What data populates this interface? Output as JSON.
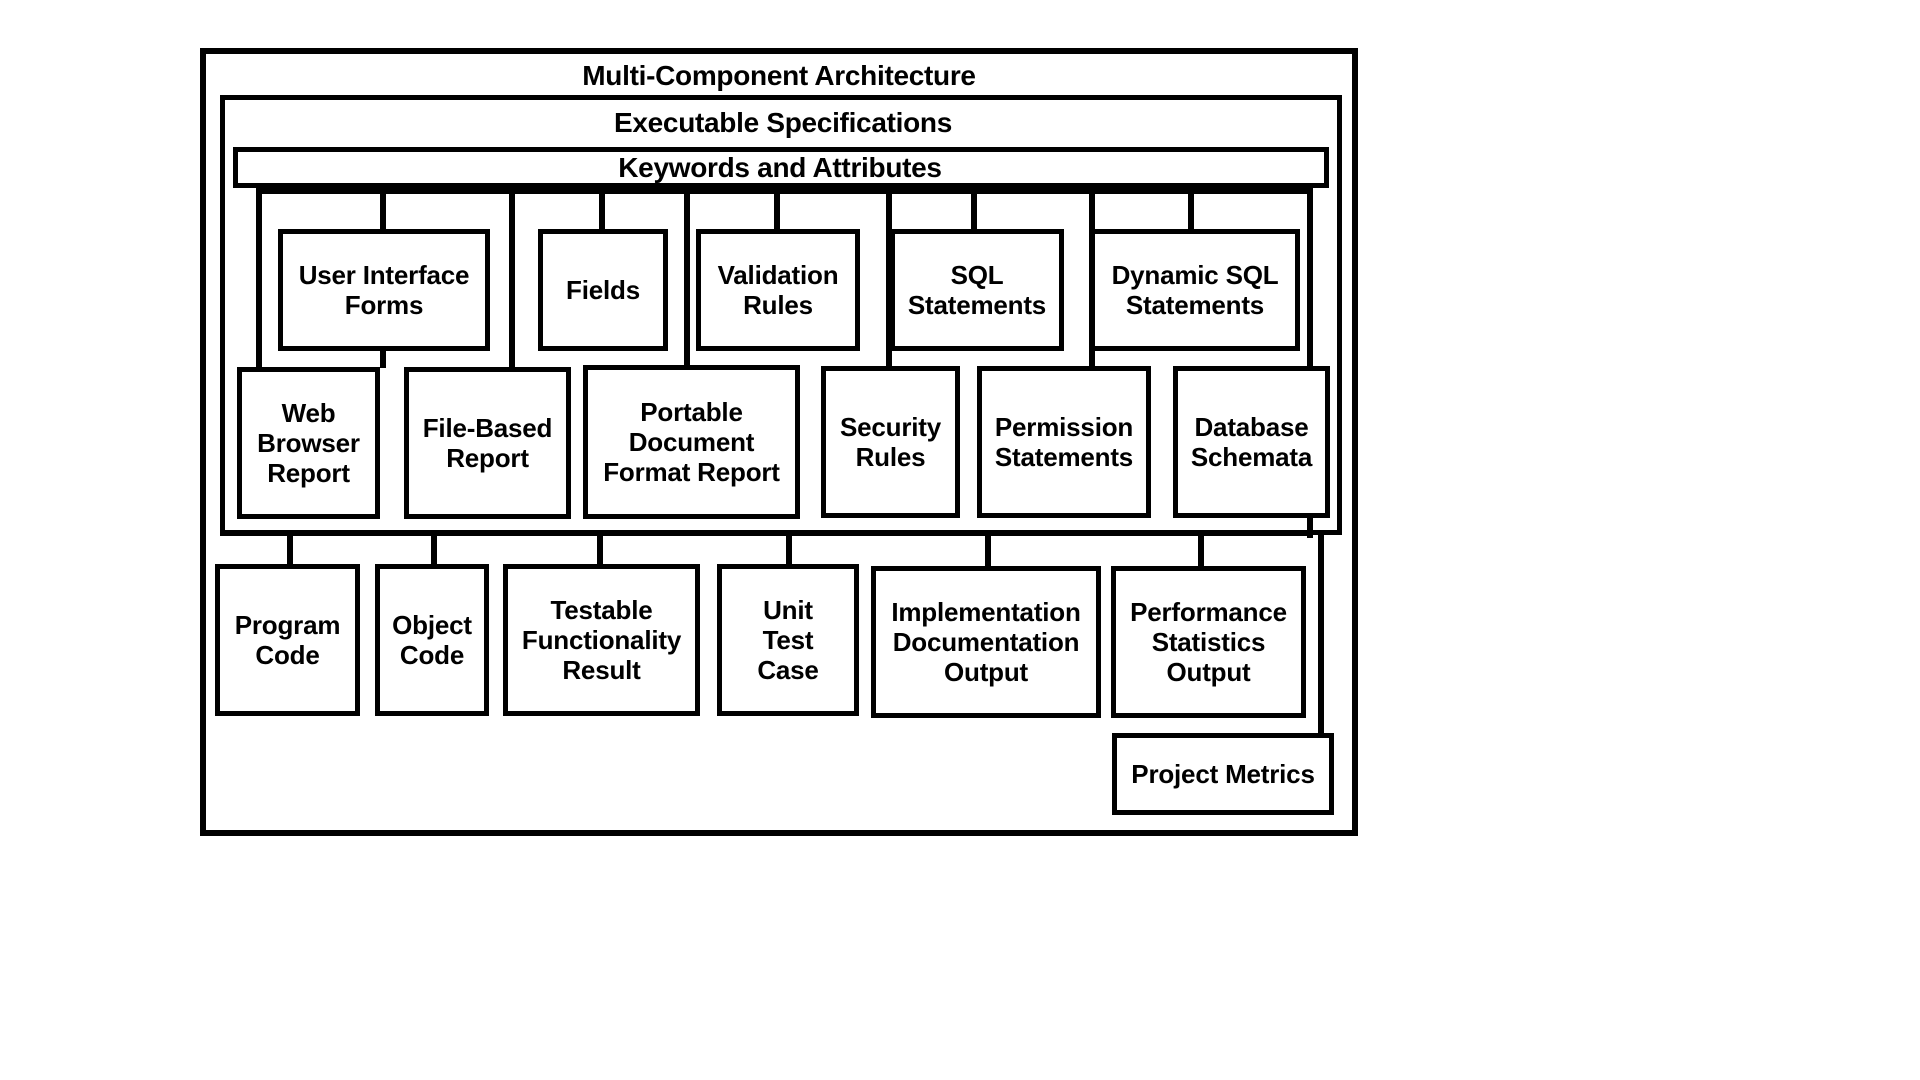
{
  "diagram": {
    "type": "block-hierarchy",
    "outer_container": {
      "title": "Multi-Component Architecture"
    },
    "level2_container": {
      "title": "Executable Specifications"
    },
    "level3_bar": {
      "title": "Keywords and Attributes"
    },
    "row1": [
      {
        "label": "User Interface\nForms",
        "line1": "User Interface",
        "line2": "Forms"
      },
      {
        "label": "Fields",
        "line1": "Fields",
        "line2": ""
      },
      {
        "label": "Validation\nRules",
        "line1": "Validation",
        "line2": "Rules"
      },
      {
        "label": "SQL\nStatements",
        "line1": "SQL",
        "line2": "Statements"
      },
      {
        "label": "Dynamic SQL\nStatements",
        "line1": "Dynamic SQL",
        "line2": "Statements"
      }
    ],
    "row2": [
      {
        "line1": "Web",
        "line2": "Browser",
        "line3": "Report"
      },
      {
        "line1": "File-Based",
        "line2": "Report",
        "line3": ""
      },
      {
        "line1": "Portable",
        "line2": "Document",
        "line3": "Format Report"
      },
      {
        "line1": "Security",
        "line2": "Rules",
        "line3": ""
      },
      {
        "line1": "Permission",
        "line2": "Statements",
        "line3": ""
      },
      {
        "line1": "Database",
        "line2": "Schemata",
        "line3": ""
      }
    ],
    "row3": [
      {
        "line1": "Program",
        "line2": "Code",
        "line3": ""
      },
      {
        "line1": "Object",
        "line2": "Code",
        "line3": ""
      },
      {
        "line1": "Testable",
        "line2": "Functionality",
        "line3": "Result"
      },
      {
        "line1": "Unit",
        "line2": "Test",
        "line3": "Case"
      },
      {
        "line1": "Implementation",
        "line2": "Documentation",
        "line3": "Output"
      },
      {
        "line1": "Performance",
        "line2": "Statistics",
        "line3": "Output"
      }
    ],
    "row4": [
      {
        "line1": "Project Metrics",
        "line2": "",
        "line3": ""
      }
    ],
    "colors": {
      "stroke": "#000000",
      "fill": "#ffffff"
    }
  }
}
